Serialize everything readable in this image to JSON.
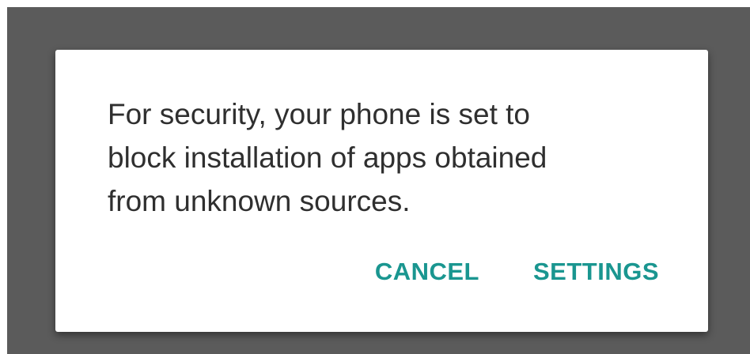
{
  "dialog": {
    "message": "For security, your phone is set to\nblock installation of apps obtained\nfrom unknown sources.",
    "buttons": {
      "cancel_label": "CANCEL",
      "settings_label": "SETTINGS"
    },
    "accent_color": "#1a9690"
  }
}
